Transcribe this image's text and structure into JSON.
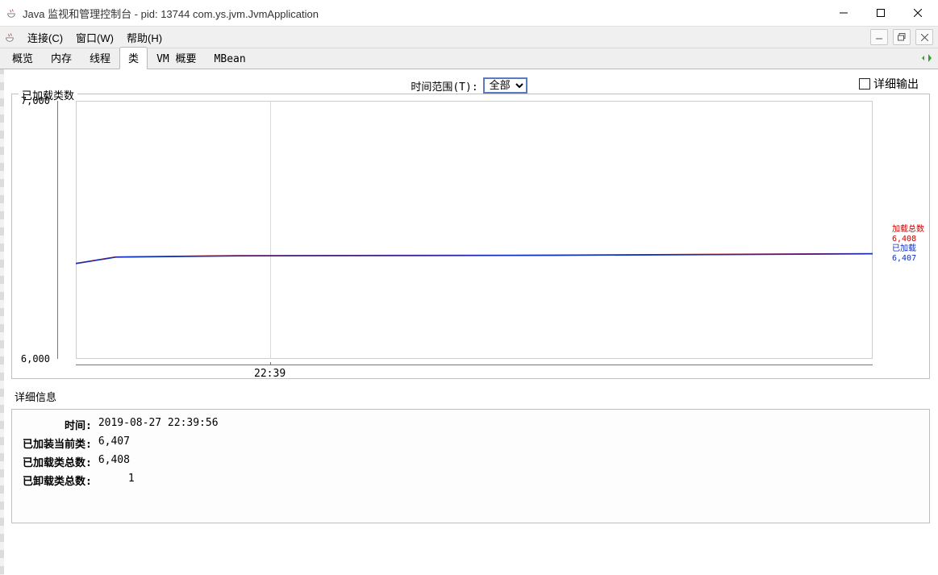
{
  "window": {
    "title": "Java 监视和管理控制台 - pid: 13744 com.ys.jvm.JvmApplication"
  },
  "menubar": {
    "connect": "连接(C)",
    "window": "窗口(W)",
    "help": "帮助(H)"
  },
  "tabs": {
    "overview": "概览",
    "memory": "内存",
    "threads": "线程",
    "classes": "类",
    "vmsum": "VM 概要",
    "mbean": "MBean"
  },
  "controls": {
    "range_label": "时间范围(T):",
    "range_value": "全部",
    "detailed_output": "详细输出"
  },
  "chart_data": {
    "type": "line",
    "title": "已加载类数",
    "ylim": [
      6000,
      7000
    ],
    "yticks": [
      "7,000",
      "6,000"
    ],
    "xticks": [
      "22:39"
    ],
    "series": [
      {
        "name": "加载总数",
        "color": "#cc0000",
        "points": [
          [
            0,
            6370
          ],
          [
            5,
            6395
          ],
          [
            20,
            6400
          ],
          [
            40,
            6401
          ],
          [
            60,
            6402
          ],
          [
            80,
            6405
          ],
          [
            100,
            6408
          ]
        ],
        "last_value": "6,408"
      },
      {
        "name": "已加载",
        "color": "#1030c0",
        "points": [
          [
            0,
            6369
          ],
          [
            5,
            6394
          ],
          [
            20,
            6399
          ],
          [
            40,
            6400
          ],
          [
            60,
            6401
          ],
          [
            80,
            6404
          ],
          [
            100,
            6407
          ]
        ],
        "last_value": "6,407"
      }
    ]
  },
  "details": {
    "section_title": "详细信息",
    "rows": [
      {
        "k": "时间:",
        "v": "2019-08-27 22:39:56"
      },
      {
        "k": "已加装当前类:",
        "v": "6,407"
      },
      {
        "k": "已加载类总数:",
        "v": "6,408"
      },
      {
        "k": "已卸载类总数:",
        "v": "1"
      }
    ]
  }
}
